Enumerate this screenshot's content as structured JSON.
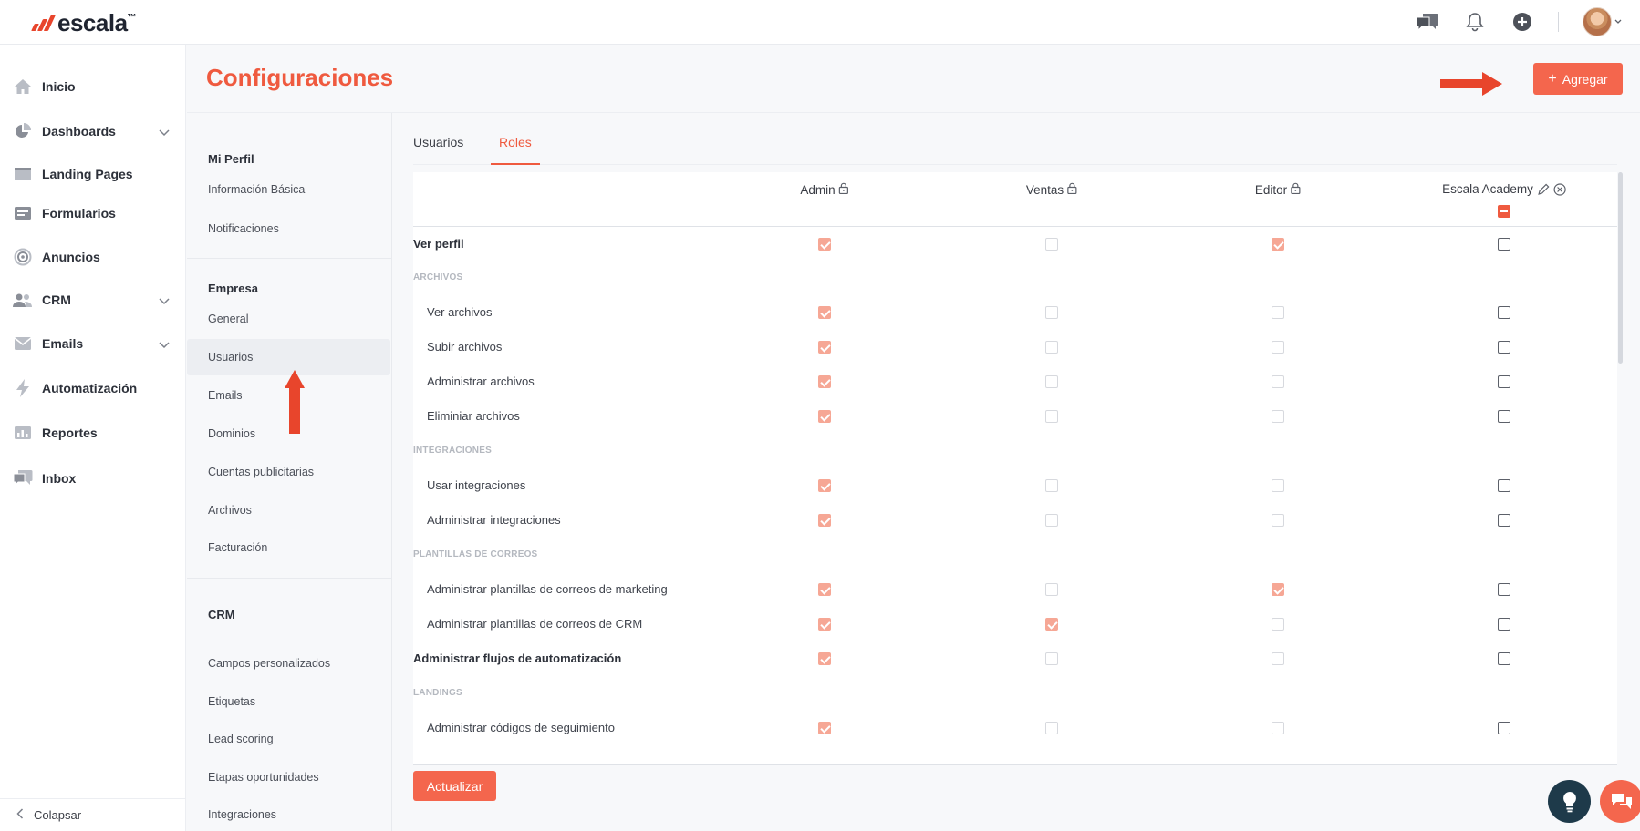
{
  "brand": {
    "name": "escala",
    "tm": "™",
    "accent": "#ef5a3f"
  },
  "topbar": {
    "icons": [
      "chat-bubbles-icon",
      "bell-icon",
      "plus-circle-icon",
      "avatar"
    ]
  },
  "sidebar": {
    "items": [
      {
        "label": "Inicio",
        "icon": "home-icon",
        "expandable": false
      },
      {
        "label": "Dashboards",
        "icon": "pie-chart-icon",
        "expandable": true
      },
      {
        "label": "Landing Pages",
        "icon": "landing-page-icon",
        "expandable": false
      },
      {
        "label": "Formularios",
        "icon": "form-icon",
        "expandable": false
      },
      {
        "label": "Anuncios",
        "icon": "target-icon",
        "expandable": false
      },
      {
        "label": "CRM",
        "icon": "people-icon",
        "expandable": true
      },
      {
        "label": "Emails",
        "icon": "envelope-icon",
        "expandable": true
      },
      {
        "label": "Automatización",
        "icon": "lightning-icon",
        "expandable": false
      },
      {
        "label": "Reportes",
        "icon": "bar-chart-icon",
        "expandable": false
      },
      {
        "label": "Inbox",
        "icon": "inbox-chat-icon",
        "expandable": false
      }
    ],
    "collapse_label": "Colapsar"
  },
  "header": {
    "title": "Configuraciones",
    "add_label": "Agregar"
  },
  "submenu": {
    "groups": [
      {
        "title": "Mi Perfil",
        "items": [
          "Información Básica",
          "Notificaciones"
        ]
      },
      {
        "title": "Empresa",
        "items": [
          "General",
          "Usuarios",
          "Emails",
          "Dominios",
          "Cuentas publicitarias",
          "Archivos",
          "Facturación"
        ]
      },
      {
        "title": "CRM",
        "items": [
          "Campos personalizados",
          "Etiquetas",
          "Lead scoring",
          "Etapas oportunidades",
          "Integraciones"
        ]
      }
    ],
    "active": "Usuarios"
  },
  "tabs": [
    {
      "label": "Usuarios",
      "active": false
    },
    {
      "label": "Roles",
      "active": true
    }
  ],
  "roles": [
    {
      "name": "Admin",
      "locked": true
    },
    {
      "name": "Ventas",
      "locked": true
    },
    {
      "name": "Editor",
      "locked": true
    },
    {
      "name": "Escala Academy",
      "locked": false,
      "editable": true
    }
  ],
  "permissions": [
    {
      "type": "perm",
      "label": "Ver perfil",
      "level": 0,
      "values": [
        true,
        false,
        true,
        false
      ]
    },
    {
      "type": "section",
      "label": "ARCHIVOS"
    },
    {
      "type": "perm",
      "label": "Ver archivos",
      "level": 1,
      "values": [
        true,
        false,
        false,
        false
      ]
    },
    {
      "type": "perm",
      "label": "Subir archivos",
      "level": 1,
      "values": [
        true,
        false,
        false,
        false
      ]
    },
    {
      "type": "perm",
      "label": "Administrar archivos",
      "level": 1,
      "values": [
        true,
        false,
        false,
        false
      ]
    },
    {
      "type": "perm",
      "label": "Eliminiar archivos",
      "level": 1,
      "values": [
        true,
        false,
        false,
        false
      ]
    },
    {
      "type": "section",
      "label": "INTEGRACIONES"
    },
    {
      "type": "perm",
      "label": "Usar integraciones",
      "level": 1,
      "values": [
        true,
        false,
        false,
        false
      ]
    },
    {
      "type": "perm",
      "label": "Administrar integraciones",
      "level": 1,
      "values": [
        true,
        false,
        false,
        false
      ]
    },
    {
      "type": "section",
      "label": "PLANTILLAS DE CORREOS"
    },
    {
      "type": "perm",
      "label": "Administrar plantillas de correos de marketing",
      "level": 1,
      "values": [
        true,
        false,
        true,
        false
      ]
    },
    {
      "type": "perm",
      "label": "Administrar plantillas de correos de CRM",
      "level": 1,
      "values": [
        true,
        true,
        false,
        false
      ]
    },
    {
      "type": "perm",
      "label": "Administrar flujos de automatización",
      "level": 0,
      "strong": true,
      "values": [
        true,
        false,
        false,
        false
      ]
    },
    {
      "type": "section",
      "label": "LANDINGS"
    },
    {
      "type": "perm",
      "label": "Administrar códigos de seguimiento",
      "level": 1,
      "values": [
        true,
        false,
        false,
        false
      ]
    }
  ],
  "footer": {
    "update_label": "Actualizar"
  },
  "fabs": [
    "lightbulb-icon",
    "support-chat-icon"
  ]
}
